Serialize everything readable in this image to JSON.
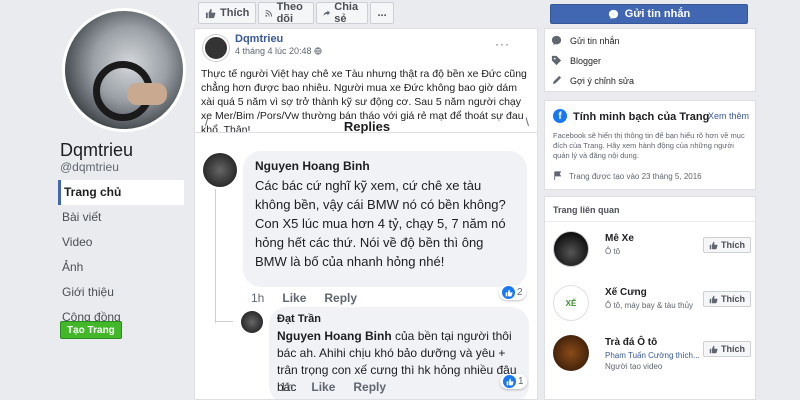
{
  "page": {
    "name": "Dqmtrieu",
    "handle": "@dqmtrieu",
    "nav": [
      "Trang chủ",
      "Bài viết",
      "Video",
      "Ảnh",
      "Giới thiệu",
      "Cộng đồng"
    ],
    "active_nav": "Trang chủ",
    "create_page": "Tạo Trang"
  },
  "actions": {
    "like": "Thích",
    "follow": "Theo dõi",
    "share": "Chia sẻ",
    "more": "..."
  },
  "post": {
    "author": "Dqmtrieu",
    "time": "4 tháng 4 lúc 20:48",
    "text": "Thực tế người Việt hay chê xe Tàu nhưng thật ra độ bền xe Đức cũng chẳng hơn được bao nhiêu. Người mua xe Đức không bao giờ dám xài quá 5 năm vì sợ trở thành kỹ sư động cơ. Sau 5 năm người chạy xe Mer/Bim /Pors/Vw thường bán tháo với giá rẻ mạt để thoát sự đau khổ. Thân!"
  },
  "replies": {
    "title": "Replies",
    "items": [
      {
        "name": "Nguyen Hoang Binh",
        "text": "Các bác cứ nghĩ kỹ xem, cứ chê xe tàu không bền, vậy cái BMW nó có bền không? Con X5 lúc mua hơn 4 tỷ, chạy 5, 7 năm nó hỏng hết các thứ. Nói về độ bền thì ông BMW là bố của nhanh hỏng nhé!",
        "time": "1h",
        "like": "Like",
        "reply": "Reply",
        "reactions": "2"
      },
      {
        "name": "Đạt Trần",
        "mention": "Nguyen Hoang Binh",
        "text": " của bền tại người thôi bác ah. Ahihi chịu khó bảo dưỡng và yêu + trân trọng con xế cưng thì hk hỏng nhiều đâu bác",
        "time": "1h",
        "like": "Like",
        "reply": "Reply",
        "reactions": "1"
      }
    ]
  },
  "sidebar": {
    "send_message": "Gửi tin nhắn",
    "info": [
      {
        "label": "Gửi tin nhắn"
      },
      {
        "label": "Blogger"
      },
      {
        "label": "Gợi ý chỉnh sửa"
      }
    ],
    "transparency": {
      "title": "Tính minh bạch của Trang",
      "more": "Xem thêm",
      "text": "Facebook sẽ hiển thị thông tin để bạn hiểu rõ hơn về mục đích của Trang. Hãy xem hành động của những người quản lý và đăng nội dung.",
      "created": "Trang được tạo vào 23 tháng 5, 2016"
    },
    "related_title": "Trang liên quan",
    "related": [
      {
        "name": "Mê Xe",
        "sub": "Ô tô",
        "sub2": "",
        "like": "Thích"
      },
      {
        "name": "Xế Cưng",
        "sub": "Ô tô, máy bay & tàu thủy",
        "sub2": "",
        "like": "Thích"
      },
      {
        "name": "Trà đá Ô tô",
        "sub": "Phạm Tuấn Cường thích...",
        "sub2": "Người tạo video",
        "like": "Thích"
      }
    ]
  },
  "colors": {
    "brand": "#4267b2",
    "link": "#385898",
    "green": "#42b72a",
    "bg": "#e9ebee"
  }
}
